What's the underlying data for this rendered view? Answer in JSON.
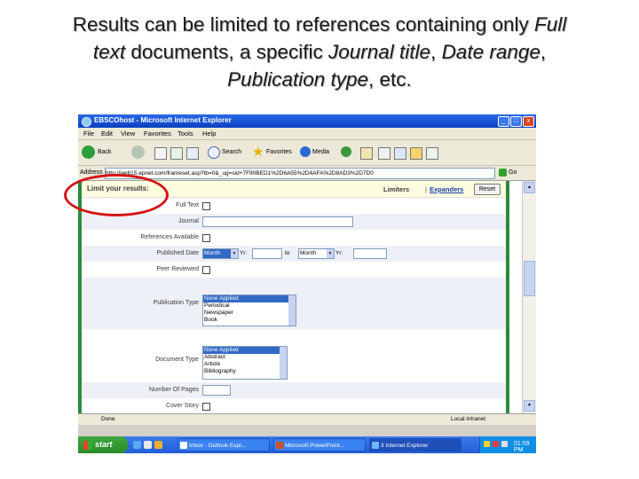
{
  "caption": {
    "line1": "Results can be limited to references containing only ",
    "line1_italic": "Full",
    "line2_italic_a": "text",
    "line2_a": " documents, a specific ",
    "line2_italic_b": "Journal title",
    "line2_b": ", ",
    "line2_italic_c": "Date range",
    "line2_c": ",",
    "line3_italic": "Publication type",
    "line3": ", etc."
  },
  "window": {
    "title": "EBSCOhost - Microsoft Internet Explorer",
    "min": "_",
    "max": "□",
    "close": "x"
  },
  "menu": [
    "File",
    "Edit",
    "View",
    "Favorites",
    "Tools",
    "Help"
  ],
  "toolbar": {
    "back": "Back",
    "search": "Search",
    "favorites": "Favorites",
    "media": "Media"
  },
  "address": {
    "label": "Address",
    "url": "http://web15.epnet.com/frameset.asp?tb=0&_ug=sid+7F90BED1%2D6A55%2D4AFA%2D8AD3%2D7D0",
    "go": "Go"
  },
  "panel": {
    "title": "Limit your results:",
    "limiters": "Limiters",
    "separator": "|",
    "expanders": "Expanders",
    "reset": "Reset"
  },
  "fields": {
    "full_text": "Full Text",
    "journal": "Journal",
    "references_available": "References Available",
    "published_date": "Published Date",
    "month_from": "Month",
    "yr": "Yr:",
    "to": "to",
    "month_to": "Month",
    "yr2": "Yr:",
    "peer_reviewed": "Peer Reviewed",
    "publication_type": "Publication Type",
    "publication_type_options": [
      "None Applied",
      "Periodical",
      "Newspaper",
      "Book"
    ],
    "document_type": "Document Type",
    "document_type_options": [
      "None Applied",
      "Abstract",
      "Article",
      "Bibliography"
    ],
    "number_of_pages": "Number Of Pages",
    "cover_story": "Cover Story"
  },
  "status": {
    "done": "Done",
    "zone": "Local intranet"
  },
  "taskbar": {
    "start": "start",
    "tasks": [
      "Inbox - Outlook Expr...",
      "Microsoft PowerPoint...",
      "3 Internet Explorer"
    ],
    "clock": "01:59 PM"
  },
  "colors": {
    "annotation": "#d41414",
    "page_border": "#2c8a3a",
    "xp_blue": "#245dd9"
  }
}
